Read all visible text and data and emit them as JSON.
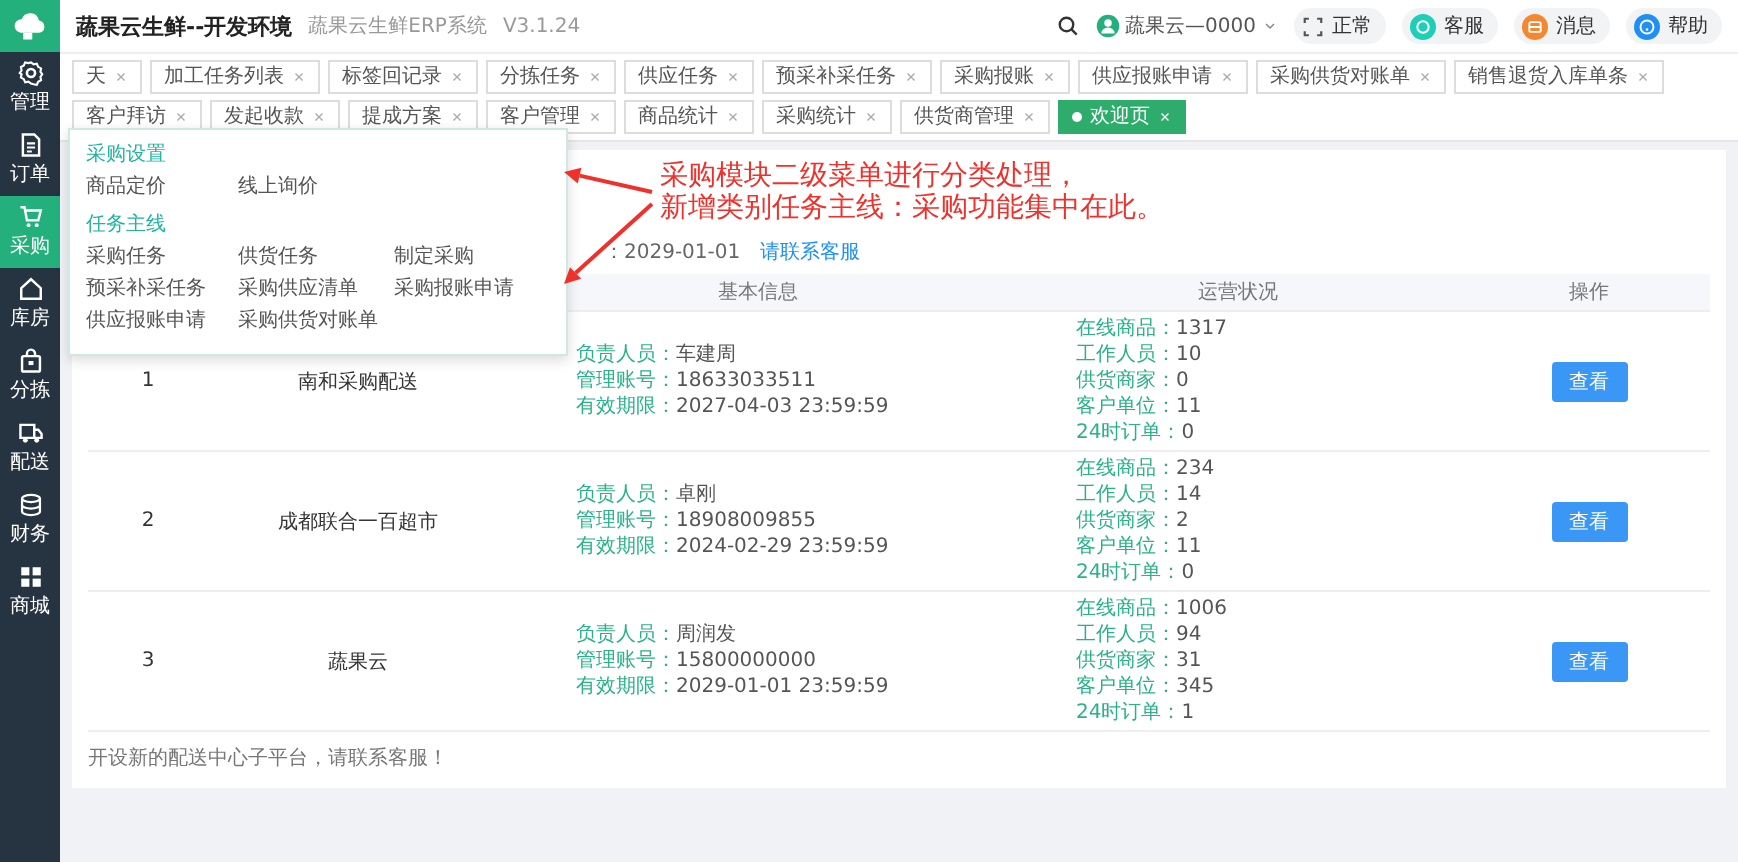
{
  "header": {
    "title": "蔬果云生鲜--开发环境",
    "subtitle": "蔬果云生鲜ERP系统",
    "version": "V3.1.24",
    "user": "蔬果云—0000",
    "buttons": [
      {
        "label": "正常",
        "kind": "fullscreen",
        "color": "#555555"
      },
      {
        "label": "客服",
        "kind": "service",
        "color": "#1ccfb6"
      },
      {
        "label": "消息",
        "kind": "message",
        "color": "#f5872e"
      },
      {
        "label": "帮助",
        "kind": "help",
        "color": "#1e8ff5"
      }
    ]
  },
  "sidebar": {
    "items": [
      {
        "label": "管理",
        "kind": "gear",
        "selected": false
      },
      {
        "label": "订单",
        "kind": "document",
        "selected": false
      },
      {
        "label": "采购",
        "kind": "cart",
        "selected": true
      },
      {
        "label": "库房",
        "kind": "house",
        "selected": false
      },
      {
        "label": "分拣",
        "kind": "bag",
        "selected": false
      },
      {
        "label": "配送",
        "kind": "truck",
        "selected": false
      },
      {
        "label": "财务",
        "kind": "database",
        "selected": false
      },
      {
        "label": "商城",
        "kind": "grid",
        "selected": false
      }
    ]
  },
  "tabs": [
    {
      "label": "天",
      "selected": false
    },
    {
      "label": "加工任务列表",
      "selected": false
    },
    {
      "label": "标签回记录",
      "selected": false
    },
    {
      "label": "分拣任务",
      "selected": false
    },
    {
      "label": "供应任务",
      "selected": false
    },
    {
      "label": "预采补采任务",
      "selected": false
    },
    {
      "label": "采购报账",
      "selected": false
    },
    {
      "label": "供应报账申请",
      "selected": false
    },
    {
      "label": "采购供货对账单",
      "selected": false
    },
    {
      "label": "销售退货入库单条",
      "selected": false
    },
    {
      "label": "客户拜访",
      "selected": false
    },
    {
      "label": "发起收款",
      "selected": false
    },
    {
      "label": "提成方案",
      "selected": false
    },
    {
      "label": "客户管理",
      "selected": false
    },
    {
      "label": "商品统计",
      "selected": false
    },
    {
      "label": "采购统计",
      "selected": false
    },
    {
      "label": "供货商管理",
      "selected": false
    },
    {
      "label": "欢迎页",
      "selected": true
    }
  ],
  "content": {
    "info": {
      "date": "：2029-01-01",
      "link": "请联系客服"
    },
    "table": {
      "columns": [
        "基本信息",
        "运营状况",
        "操作"
      ],
      "rows": [
        {
          "index": "1",
          "name": "南和采购配送",
          "info": [
            {
              "label": "负责人员：",
              "value": "车建周"
            },
            {
              "label": "管理账号：",
              "value": "18633033511"
            },
            {
              "label": "有效期限：",
              "value": "2027-04-03 23:59:59"
            }
          ],
          "stats": [
            {
              "label": "在线商品：",
              "value": "1317"
            },
            {
              "label": "工作人员：",
              "value": "10"
            },
            {
              "label": "供货商家：",
              "value": "0"
            },
            {
              "label": "客户单位：",
              "value": "11"
            },
            {
              "label": "24时订单：",
              "value": "0"
            }
          ],
          "action": "查看"
        },
        {
          "index": "2",
          "name": "成都联合一百超市",
          "info": [
            {
              "label": "负责人员：",
              "value": "卓刚"
            },
            {
              "label": "管理账号：",
              "value": "18908009855"
            },
            {
              "label": "有效期限：",
              "value": "2024-02-29 23:59:59"
            }
          ],
          "stats": [
            {
              "label": "在线商品：",
              "value": "234"
            },
            {
              "label": "工作人员：",
              "value": "14"
            },
            {
              "label": "供货商家：",
              "value": "2"
            },
            {
              "label": "客户单位：",
              "value": "11"
            },
            {
              "label": "24时订单：",
              "value": "0"
            }
          ],
          "action": "查看"
        },
        {
          "index": "3",
          "name": "蔬果云",
          "info": [
            {
              "label": "负责人员：",
              "value": "周润发"
            },
            {
              "label": "管理账号：",
              "value": "15800000000"
            },
            {
              "label": "有效期限：",
              "value": "2029-01-01 23:59:59"
            }
          ],
          "stats": [
            {
              "label": "在线商品：",
              "value": "1006"
            },
            {
              "label": "工作人员：",
              "value": "94"
            },
            {
              "label": "供货商家：",
              "value": "31"
            },
            {
              "label": "客户单位：",
              "value": "345"
            },
            {
              "label": "24时订单：",
              "value": "1"
            }
          ],
          "action": "查看"
        }
      ]
    },
    "footer": "开设新的配送中心子平台，请联系客服！"
  },
  "popup": {
    "sections": [
      {
        "title": "采购设置",
        "items": [
          "商品定价",
          "线上询价"
        ]
      },
      {
        "title": "任务主线",
        "items": [
          "采购任务",
          "供货任务",
          "制定采购",
          "预采补采任务",
          "采购供应清单",
          "采购报账申请",
          "供应报账申请",
          "采购供货对账单"
        ]
      }
    ]
  },
  "annotation": {
    "lines": [
      "采购模块二级菜单进行分类处理，",
      "新增类别任务主线：采购功能集中在此。"
    ]
  }
}
